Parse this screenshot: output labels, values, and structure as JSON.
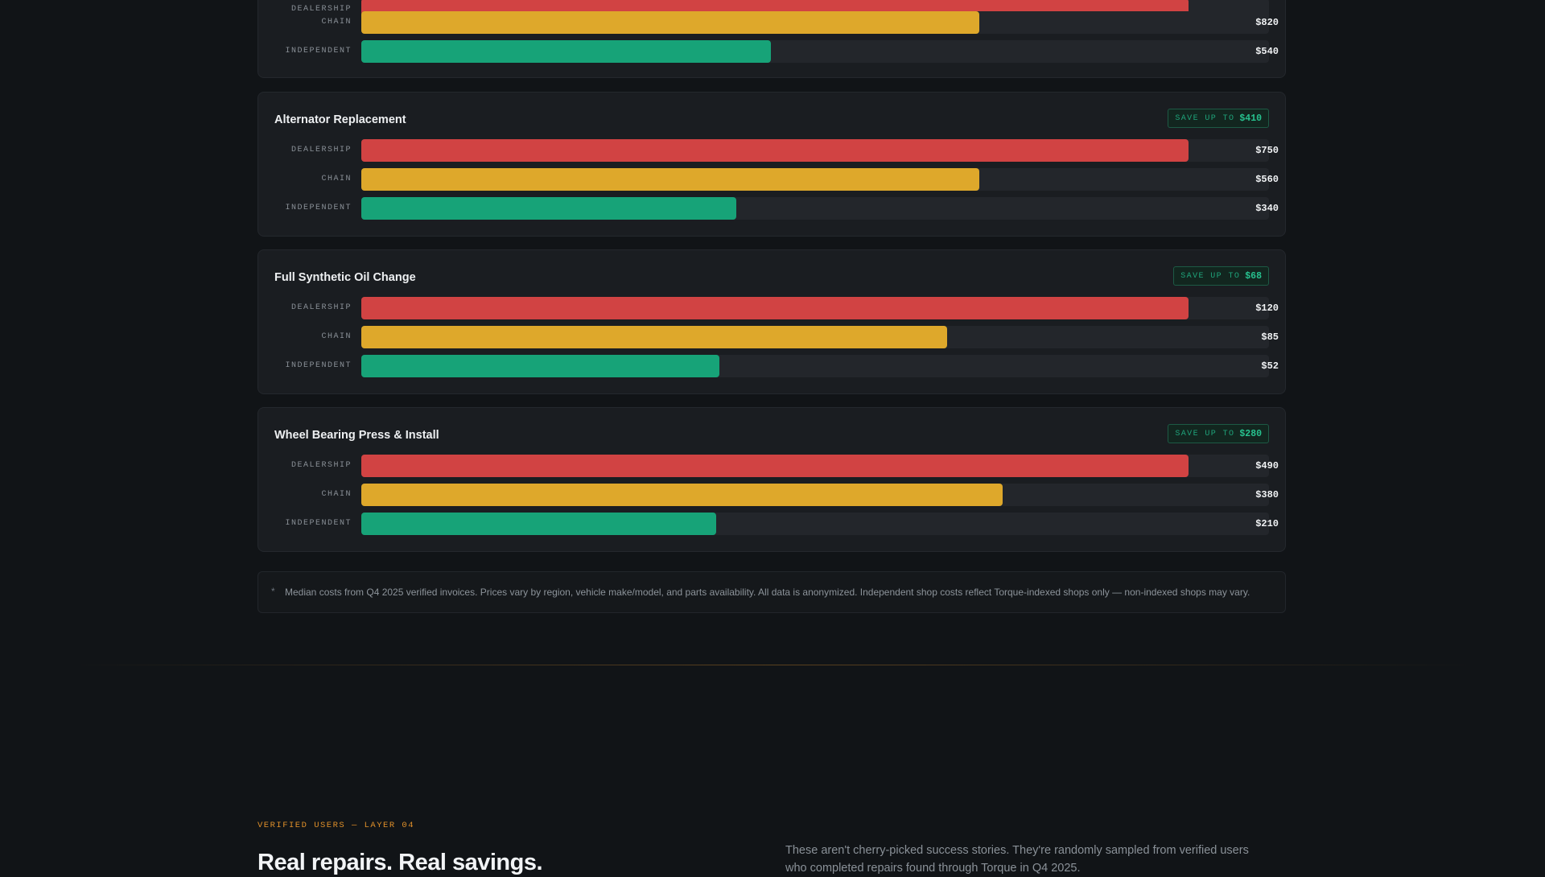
{
  "colors": {
    "dealership": "#d14343",
    "chain": "#dea82b",
    "independent": "#17a378",
    "accent": "#e0902a",
    "save": "#27c28f"
  },
  "max_price_scale": 1,
  "cards": [
    {
      "title": "",
      "save_label": "",
      "save_amount": "",
      "rows": [
        {
          "tier": "DEALERSHIP",
          "price": "",
          "ratio": 1.0
        },
        {
          "tier": "CHAIN",
          "price": "$820",
          "ratio": 0.7467
        },
        {
          "tier": "INDEPENDENT",
          "price": "$540",
          "ratio": 0.4947
        }
      ]
    },
    {
      "title": "Alternator Replacement",
      "save_label": "SAVE UP TO",
      "save_amount": "$410",
      "rows": [
        {
          "tier": "DEALERSHIP",
          "price": "$750",
          "ratio": 1.0
        },
        {
          "tier": "CHAIN",
          "price": "$560",
          "ratio": 0.7467
        },
        {
          "tier": "INDEPENDENT",
          "price": "$340",
          "ratio": 0.4533
        }
      ]
    },
    {
      "title": "Full Synthetic Oil Change",
      "save_label": "SAVE UP TO",
      "save_amount": "$68",
      "rows": [
        {
          "tier": "DEALERSHIP",
          "price": "$120",
          "ratio": 1.0
        },
        {
          "tier": "CHAIN",
          "price": "$85",
          "ratio": 0.7083
        },
        {
          "tier": "INDEPENDENT",
          "price": "$52",
          "ratio": 0.4333
        }
      ]
    },
    {
      "title": "Wheel Bearing Press & Install",
      "save_label": "SAVE UP TO",
      "save_amount": "$280",
      "rows": [
        {
          "tier": "DEALERSHIP",
          "price": "$490",
          "ratio": 1.0
        },
        {
          "tier": "CHAIN",
          "price": "$380",
          "ratio": 0.7755
        },
        {
          "tier": "INDEPENDENT",
          "price": "$210",
          "ratio": 0.4286
        }
      ]
    }
  ],
  "footnote": {
    "bullet": "*",
    "text": "Median costs from Q4 2025 verified invoices. Prices vary by region, vehicle make/model, and parts availability. All data is anonymized. Independent shop costs reflect Torque-indexed shops only — non-indexed shops may vary."
  },
  "next_section": {
    "eyebrow": "VERIFIED USERS — LAYER 04",
    "title": "Real repairs. Real savings.",
    "description": "These aren't cherry-picked success stories. They're randomly sampled from verified users who completed repairs found through Torque in Q4 2025."
  }
}
